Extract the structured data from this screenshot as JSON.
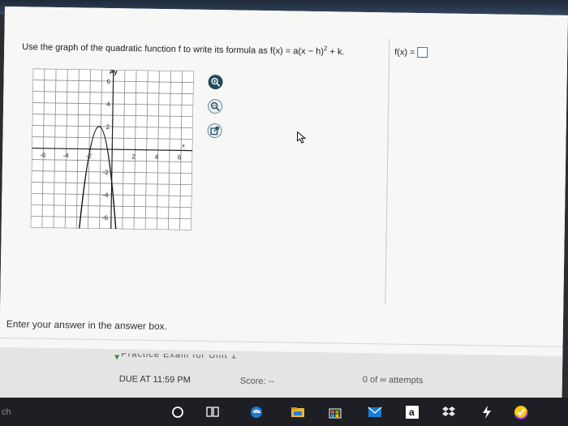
{
  "question": {
    "prefix": "Use the graph of the quadratic function f to write its formula as f(x) = a(x − h)",
    "exponent": "2",
    "suffix": " + k."
  },
  "answer": {
    "label": "f(x) ="
  },
  "graph": {
    "y_axis_label": "Ay",
    "x_axis_label": "x",
    "x_tick_labels": [
      "-6",
      "-4",
      "-2",
      "2",
      "4",
      "6"
    ],
    "y_tick_labels": [
      "6",
      "4",
      "2",
      "-2",
      "-4",
      "-6"
    ]
  },
  "tools": [
    "zoom-in-icon",
    "zoom-out-icon",
    "external-link-icon"
  ],
  "instruction": "Enter your answer in the answer box.",
  "footer": {
    "title": "Practice Exam for Unit 1",
    "due": "DUE AT 11:59 PM",
    "score": "Score: --",
    "attempts": "0 of ∞ attempts"
  },
  "taskbar": {
    "search_hint": "ch",
    "icons": [
      "cortana-icon",
      "task-view-icon",
      "edge-icon",
      "file-explorer-icon",
      "store-icon",
      "mail-icon",
      "amazon-icon",
      "dropbox-icon",
      "tidal-icon",
      "norton-icon"
    ]
  },
  "colors": {
    "answer_box_border": "#2d6bc7",
    "zoom_button_active": "#24495a",
    "taskbar_bg": "#1d1f24"
  }
}
